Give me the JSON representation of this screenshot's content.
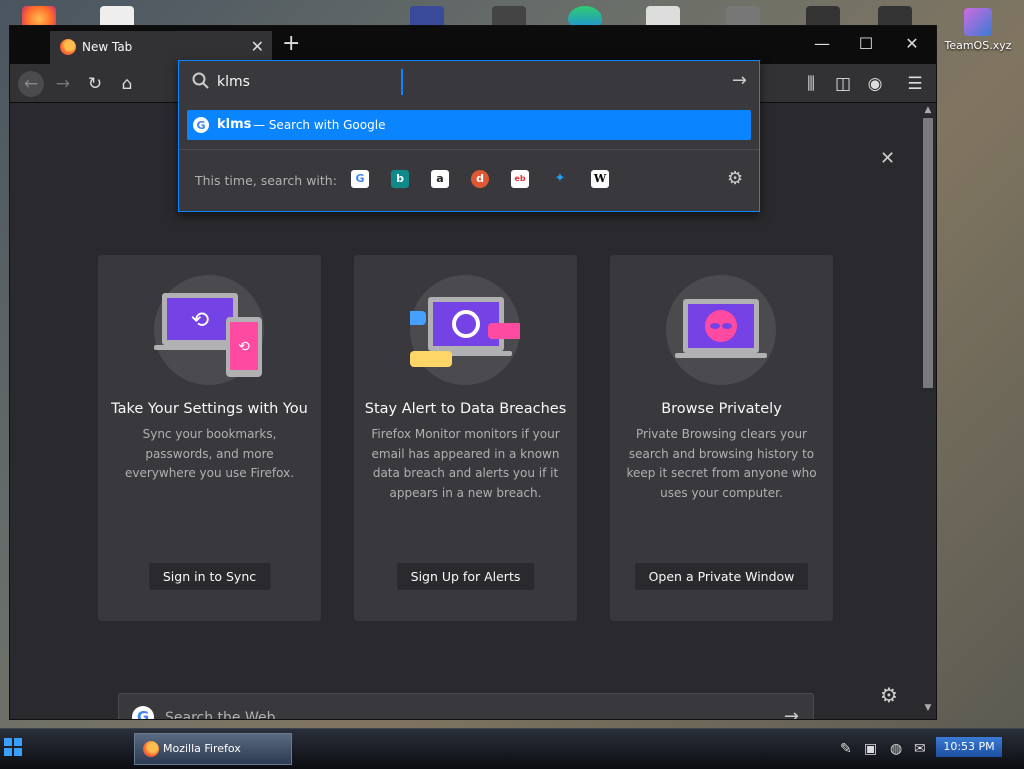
{
  "desktop": {
    "shortcut_label": "TeamOS.xyz"
  },
  "window": {
    "tab_title": "New Tab"
  },
  "urlbar": {
    "value": "klms",
    "suggestion_query": "klms",
    "suggestion_hint": "— Search with Google",
    "one_search_label": "This time, search with:",
    "engines": [
      "google-icon",
      "bing-icon",
      "amazon-icon",
      "duckduckgo-icon",
      "ebay-icon",
      "twitter-icon",
      "wikipedia-icon"
    ]
  },
  "cards": [
    {
      "title": "Take Your Settings with You",
      "body": "Sync your bookmarks, passwords, and more everywhere you use Firefox.",
      "cta": "Sign in to Sync"
    },
    {
      "title": "Stay Alert to Data Breaches",
      "body": "Firefox Monitor monitors if your email has appeared in a known data breach and alerts you if it appears in a new breach.",
      "cta": "Sign Up for Alerts"
    },
    {
      "title": "Browse Privately",
      "body": "Private Browsing clears your search and browsing history to keep it secret from anyone who uses your computer.",
      "cta": "Open a Private Window"
    }
  ],
  "search": {
    "placeholder": "Search the Web"
  },
  "taskbar": {
    "task_label": "Mozilla Firefox",
    "clock": "10:53 PM"
  },
  "colors": {
    "accent": "#0a84ff",
    "page_bg": "#2a2a2e",
    "card_bg": "#38383d"
  }
}
